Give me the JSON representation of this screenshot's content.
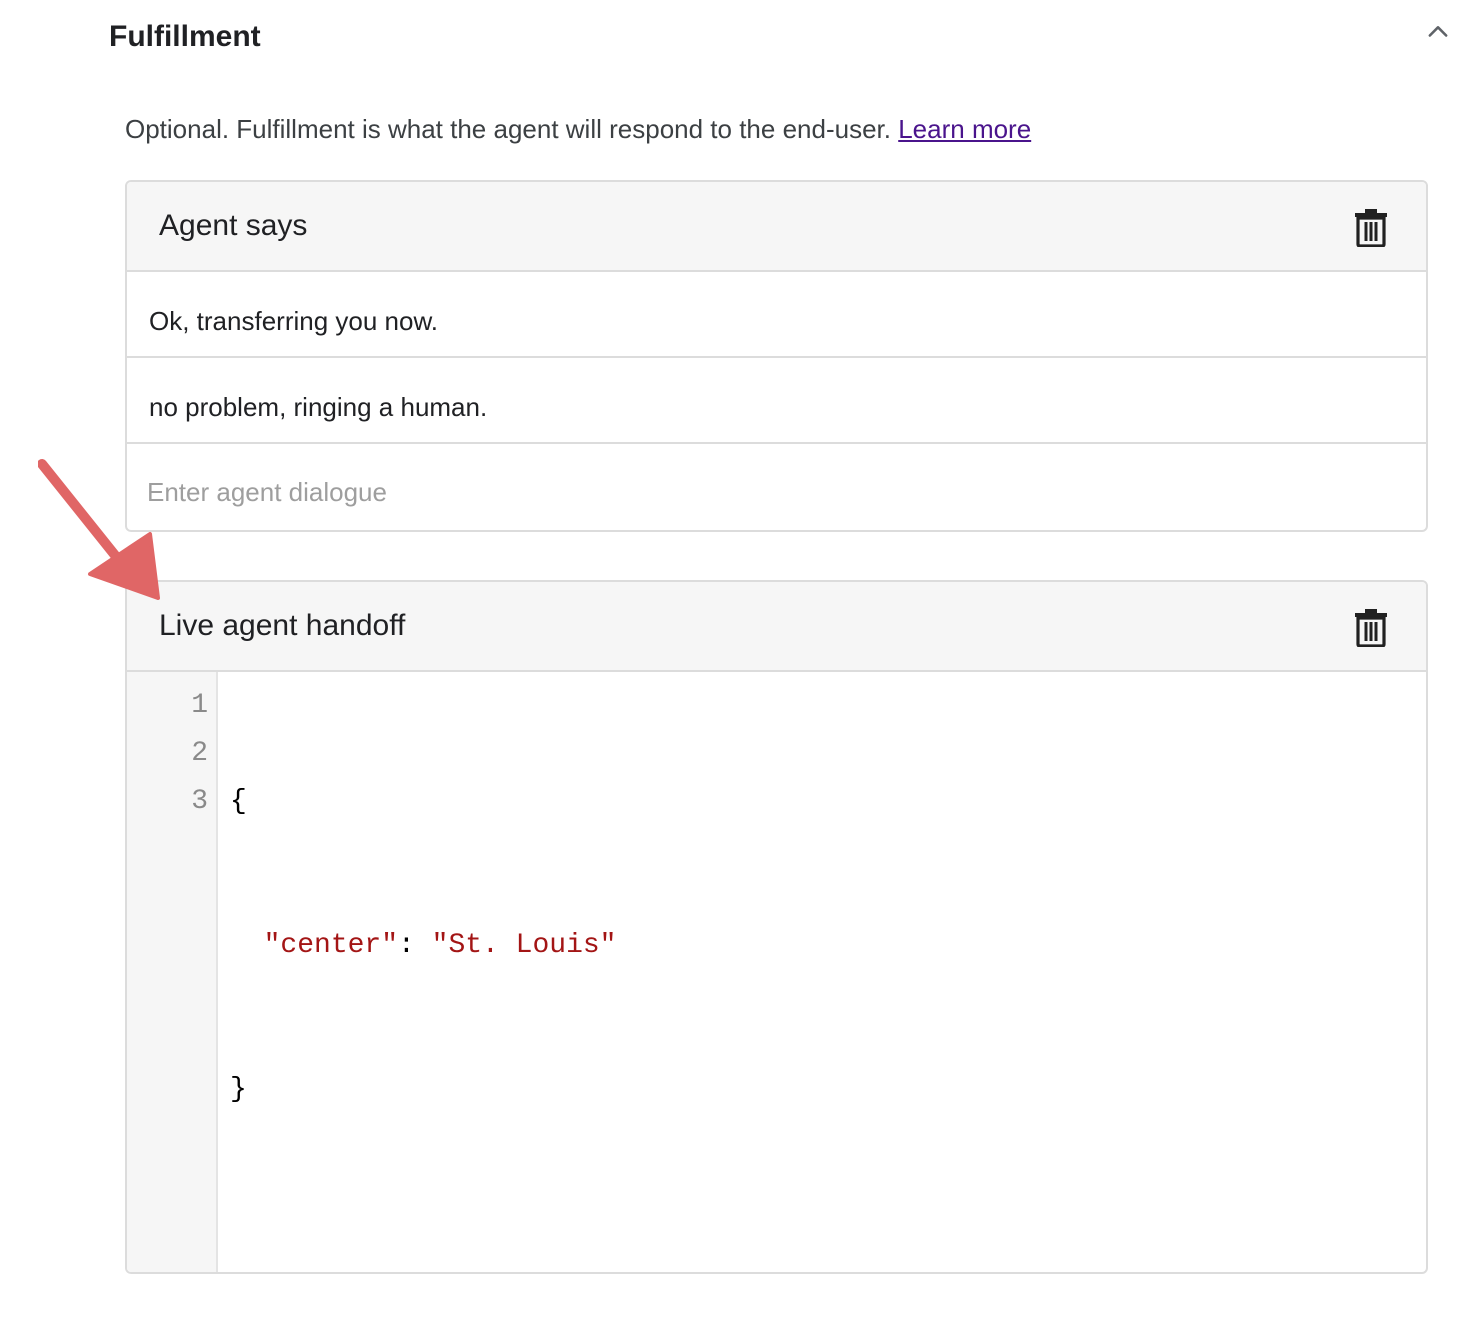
{
  "section": {
    "title": "Fulfillment",
    "description": "Optional. Fulfillment is what the agent will respond to the end-user.",
    "learn_more": "Learn more",
    "collapse_icon": "chevron-up-icon"
  },
  "agent_says": {
    "title": "Agent says",
    "delete_icon": "trash-icon",
    "responses": [
      "Ok, transferring you now.",
      "no problem, ringing a human."
    ],
    "input_placeholder": "Enter agent dialogue",
    "input_value": ""
  },
  "live_agent_handoff": {
    "title": "Live agent handoff",
    "delete_icon": "trash-icon",
    "line_numbers": [
      "1",
      "2",
      "3"
    ],
    "code": {
      "open_brace": "{",
      "indent": "  ",
      "key": "\"center\"",
      "colon": ": ",
      "value": "\"St. Louis\"",
      "close_brace": "}"
    }
  },
  "annotation": {
    "arrow_color": "#e06666",
    "arrow_icon": "annotation-arrow-icon"
  },
  "colors": {
    "link": "#4a148c",
    "json_string": "#a31515",
    "placeholder": "#9e9e9e",
    "header_bg": "#f6f6f6",
    "border": "#dcdcdc"
  }
}
